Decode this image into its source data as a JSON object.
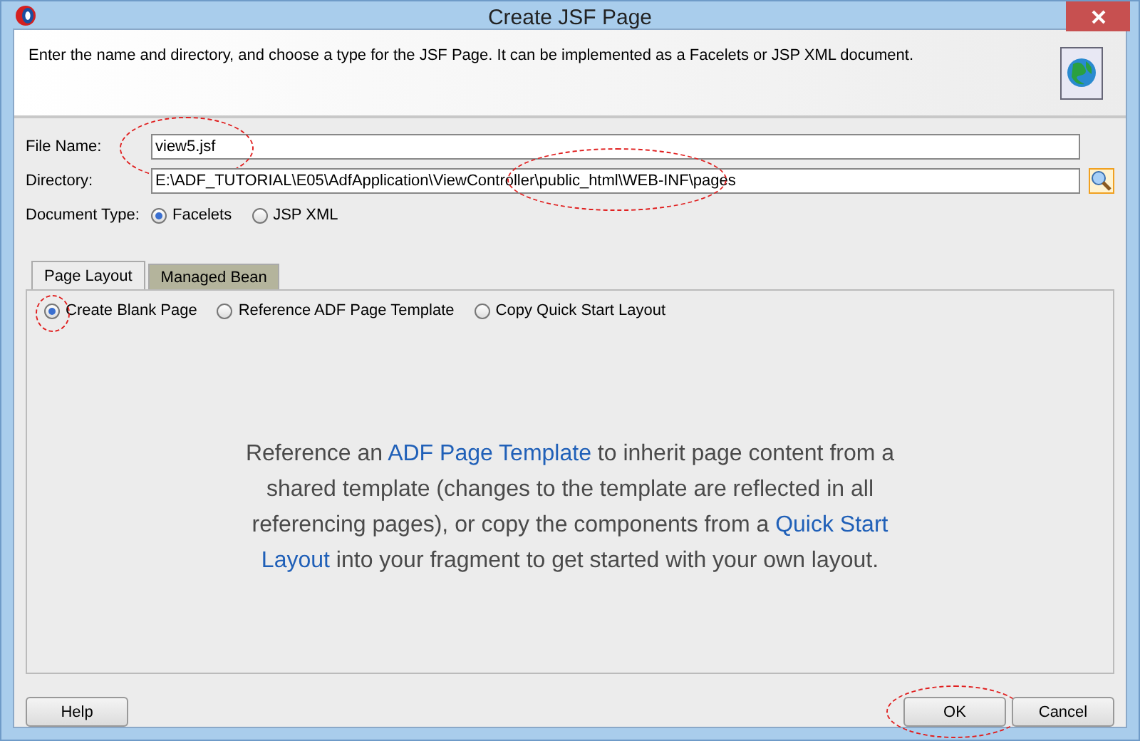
{
  "window": {
    "title": "Create JSF Page"
  },
  "header": {
    "description": "Enter the name and directory, and choose a type for the JSF Page. It can be implemented as a Facelets or JSP XML document."
  },
  "fields": [
    {
      "label": "File Name:",
      "value": "view5.jsf",
      "circled": true,
      "browse": false
    },
    {
      "label": "Directory:",
      "value": "E:\\ADF_TUTORIAL\\E05\\AdfApplication\\ViewController\\public_html\\WEB-INF\\pages",
      "circled": true,
      "browse": true
    }
  ],
  "document_type": {
    "label": "Document Type:",
    "options": [
      {
        "label": "Facelets",
        "selected": true
      },
      {
        "label": "JSP XML",
        "selected": false
      }
    ]
  },
  "tabs": [
    {
      "label": "Page Layout",
      "selected": true
    },
    {
      "label": "Managed Bean",
      "selected": false
    }
  ],
  "layout_options": [
    {
      "label": "Create Blank Page",
      "selected": true,
      "circled": true
    },
    {
      "label": "Reference ADF Page Template",
      "selected": false,
      "circled": false
    },
    {
      "label": "Copy Quick Start Layout",
      "selected": false,
      "circled": false
    }
  ],
  "info": "Reference an *ADF Page Template* to inherit page content from a shared template (changes to the template are reflected in all referencing pages), or copy the components from a *Quick Start Layout* into your fragment to get started with your own layout.",
  "buttons": [
    {
      "label": "Help",
      "kind": "left",
      "circled": false
    },
    {
      "label": "OK",
      "kind": "right",
      "circled": true
    },
    {
      "label": "Cancel",
      "kind": "right",
      "circled": false
    }
  ]
}
